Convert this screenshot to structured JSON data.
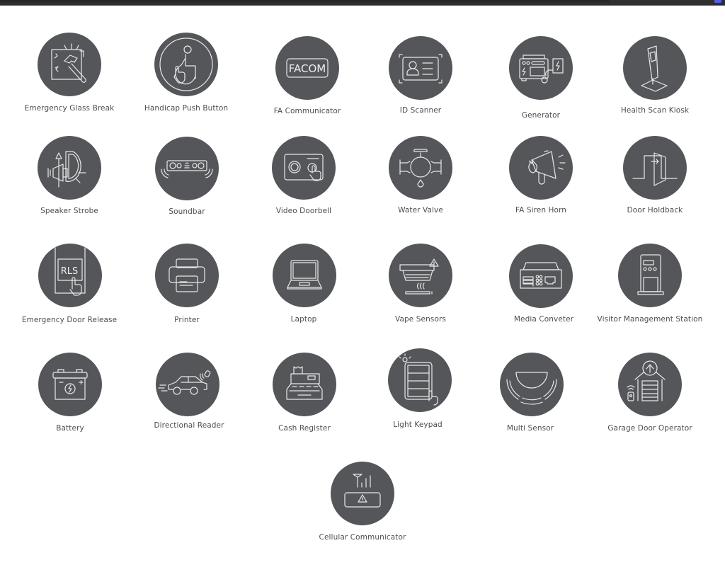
{
  "colors": {
    "circle": "#54565a",
    "label": "#4c4d50",
    "icon_stroke": "#e8e8e8",
    "topbar": "#2f2f2f",
    "topbar_indicator": "#5560e8"
  },
  "devices": [
    {
      "label": "Emergency Glass Break",
      "icon": "glass-break-icon"
    },
    {
      "label": "Handicap Push Button",
      "icon": "handicap-push-button-icon"
    },
    {
      "label": "FA Communicator",
      "icon": "facom-icon",
      "icon_text": "FACOM"
    },
    {
      "label": "ID Scanner",
      "icon": "id-card-icon"
    },
    {
      "label": "Generator",
      "icon": "generator-icon"
    },
    {
      "label": "Health Scan Kiosk",
      "icon": "kiosk-icon"
    },
    {
      "label": "Speaker Strobe",
      "icon": "speaker-strobe-icon"
    },
    {
      "label": "Soundbar",
      "icon": "soundbar-icon"
    },
    {
      "label": "Video Doorbell",
      "icon": "video-doorbell-icon"
    },
    {
      "label": "Water Valve",
      "icon": "water-valve-icon"
    },
    {
      "label": "FA Siren Horn",
      "icon": "siren-horn-icon"
    },
    {
      "label": "Door Holdback",
      "icon": "door-open-icon"
    },
    {
      "label": "Emergency Door Release",
      "icon": "door-release-icon",
      "icon_text": "RLS"
    },
    {
      "label": "Printer",
      "icon": "printer-icon"
    },
    {
      "label": "Laptop",
      "icon": "laptop-icon"
    },
    {
      "label": "Vape Sensors",
      "icon": "vape-sensor-icon"
    },
    {
      "label": "Media Conveter",
      "icon": "media-converter-icon"
    },
    {
      "label": "Visitor Management Station",
      "icon": "visitor-station-icon"
    },
    {
      "label": "Battery",
      "icon": "battery-icon"
    },
    {
      "label": "Directional Reader",
      "icon": "car-reader-icon"
    },
    {
      "label": "Cash Register",
      "icon": "cash-register-icon"
    },
    {
      "label": "Light Keypad",
      "icon": "light-keypad-icon"
    },
    {
      "label": "Multi Sensor",
      "icon": "multi-sensor-icon"
    },
    {
      "label": "Garage Door Operator",
      "icon": "garage-door-icon"
    },
    {
      "label": "Cellular Communicator",
      "icon": "cellular-communicator-icon"
    }
  ]
}
